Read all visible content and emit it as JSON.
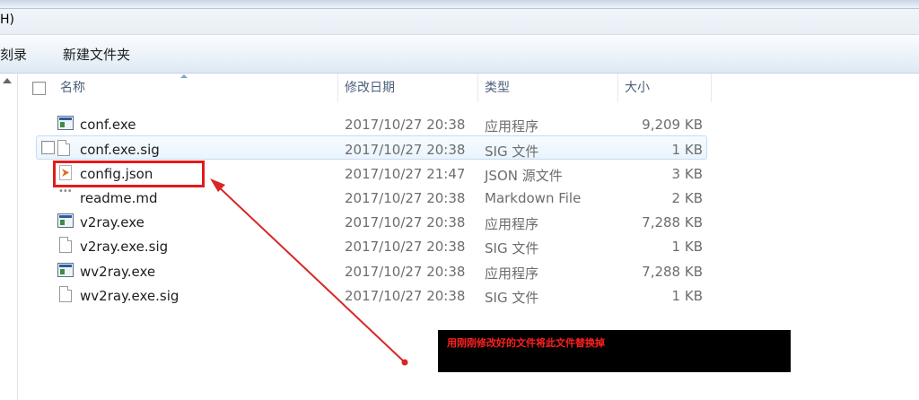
{
  "menubar": {
    "items": [
      "H)"
    ]
  },
  "toolbar": {
    "burn_label": "刻录",
    "new_folder_label": "新建文件夹"
  },
  "columns": {
    "name": "名称",
    "date": "修改日期",
    "type": "类型",
    "size": "大小"
  },
  "files": [
    {
      "name": "conf.exe",
      "date": "2017/10/27 20:38",
      "type": "应用程序",
      "size": "9,209 KB",
      "icon": "exe-icon"
    },
    {
      "name": "conf.exe.sig",
      "date": "2017/10/27 20:38",
      "type": "SIG 文件",
      "size": "1 KB",
      "icon": "document-icon"
    },
    {
      "name": "config.json",
      "date": "2017/10/27 21:47",
      "type": "JSON 源文件",
      "size": "3 KB",
      "icon": "json-file-icon"
    },
    {
      "name": "readme.md",
      "date": "2017/10/27 20:38",
      "type": "Markdown File",
      "size": "2 KB",
      "icon": "markdown-file-icon"
    },
    {
      "name": "v2ray.exe",
      "date": "2017/10/27 20:38",
      "type": "应用程序",
      "size": "7,288 KB",
      "icon": "exe-icon"
    },
    {
      "name": "v2ray.exe.sig",
      "date": "2017/10/27 20:38",
      "type": "SIG 文件",
      "size": "1 KB",
      "icon": "document-icon"
    },
    {
      "name": "wv2ray.exe",
      "date": "2017/10/27 20:38",
      "type": "应用程序",
      "size": "7,288 KB",
      "icon": "exe-icon"
    },
    {
      "name": "wv2ray.exe.sig",
      "date": "2017/10/27 20:38",
      "type": "SIG 文件",
      "size": "1 KB",
      "icon": "document-icon"
    }
  ],
  "annotation": {
    "note": "用刚刚修改好的文件将此文件替换掉",
    "highlight_color": "#e21b1b",
    "note_bg": "#000000"
  }
}
